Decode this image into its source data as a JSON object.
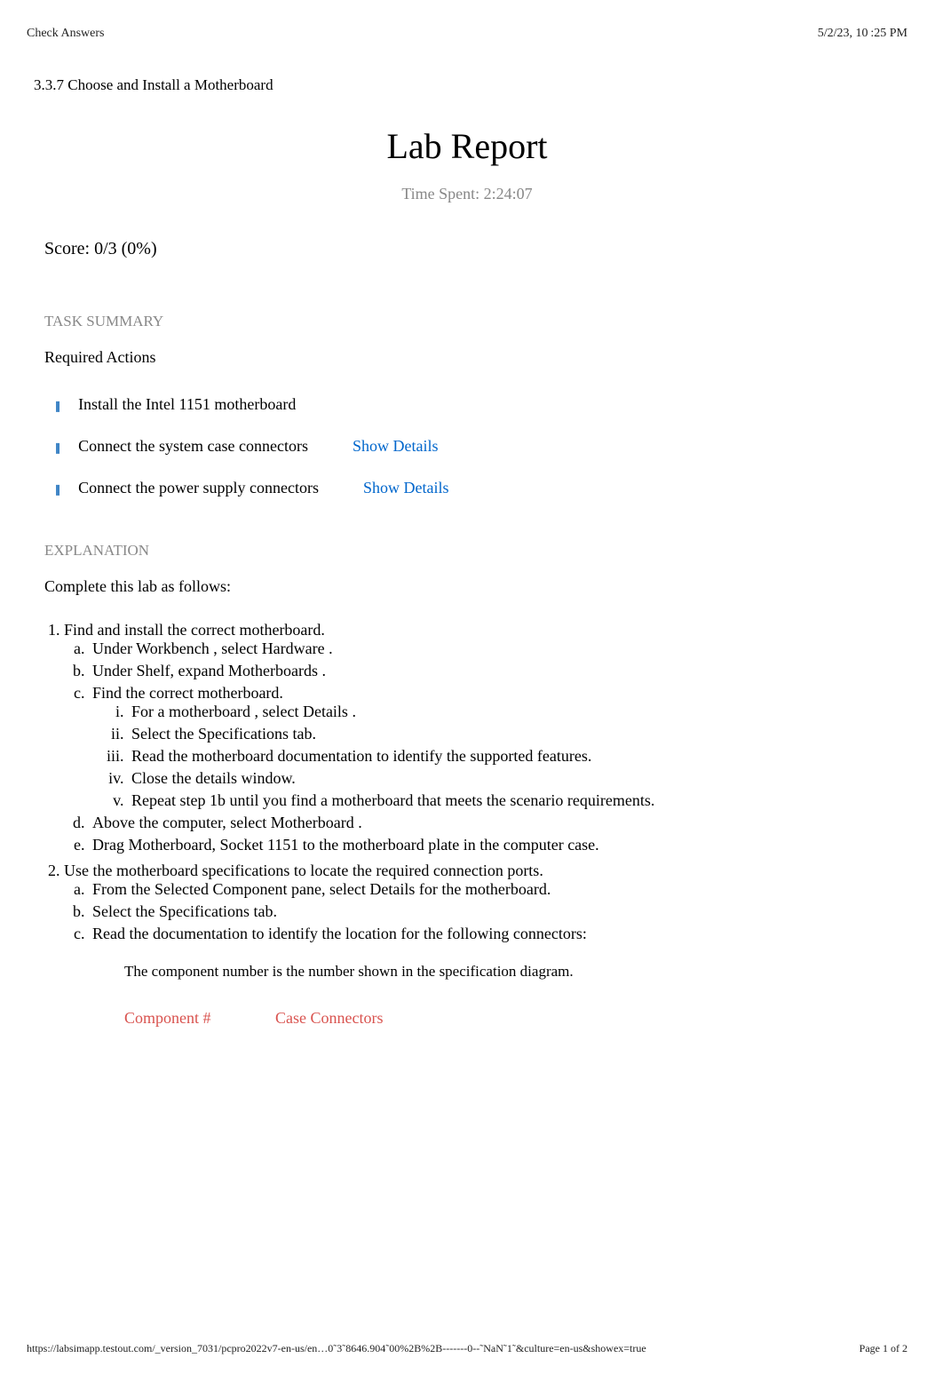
{
  "header": {
    "left": "Check Answers",
    "right": "5/2/23, 10 :25 PM"
  },
  "section_title": "3.3.7 Choose and Install a Motherboard",
  "lab_title": "Lab Report",
  "time_spent": "Time Spent: 2:24:07",
  "score": "Score: 0/3 (0%)",
  "task_summary_heading": "TASK SUMMARY",
  "required_actions_heading": "Required Actions",
  "show_details_label": "Show Details",
  "actions": [
    {
      "text": "Install the Intel 1151 motherboard",
      "has_details": false
    },
    {
      "text": "Connect the system case connectors",
      "has_details": true
    },
    {
      "text": "Connect the power supply connectors",
      "has_details": true
    }
  ],
  "explanation_heading": "EXPLANATION",
  "explanation_intro": "Complete this lab as follows:",
  "steps": {
    "step1": {
      "title": "Find and install the correct motherboard.",
      "a_pre": "Under  ",
      "a_b1": "Workbench",
      "a_mid": " , select  ",
      "a_b2": "Hardware",
      "a_post": " .",
      "b_pre": "Under Shelf, expand    ",
      "b_b1": "Motherboards",
      "b_post": "   .",
      "c_title": "Find the correct motherboard.",
      "c_i_pre": "For a  ",
      "c_i_b1": "motherboard",
      "c_i_mid": "  , select  ",
      "c_i_b2": "Details",
      "c_i_post": " .",
      "c_ii_pre": "Select the   ",
      "c_ii_b1": "Specifications",
      "c_ii_post": "   tab.",
      "c_iii_pre": "Read the   ",
      "c_iii_b1": "motherboard documentation",
      "c_iii_post": "    to identify the supported features.",
      "c_iv": "Close the details window.",
      "c_v": "Repeat step 1b until you find a motherboard that meets the scenario requirements.",
      "d_pre": "Above the computer, select     ",
      "d_b1": "Motherboard",
      "d_post": "   .",
      "e_pre": "Drag   ",
      "e_b1": "Motherboard, Socket 1151",
      "e_post": "     to the motherboard plate in the computer case."
    },
    "step2": {
      "title": "Use the motherboard specifications to locate the required connection ports.",
      "a_pre": "From the Selected Component pane, select       ",
      "a_b1": "Details",
      "a_post": "   for the motherboard.",
      "b_pre": "Select the   ",
      "b_b1": "Specifications",
      "b_post": "   tab.",
      "c": "Read the documentation to identify the location for the following connectors:"
    }
  },
  "note": "The component number is the number shown in the specification diagram.",
  "table": {
    "col1": "Component #",
    "col2": "Case Connectors"
  },
  "footer": {
    "url": "https://labsimapp.testout.com/_version_7031/pcpro2022v7-en-us/en…0˜3˜8646.904˜00%2B%2B-------0--˜NaN˜1˜&culture=en-us&showex=true",
    "page": "Page 1 of 2"
  }
}
